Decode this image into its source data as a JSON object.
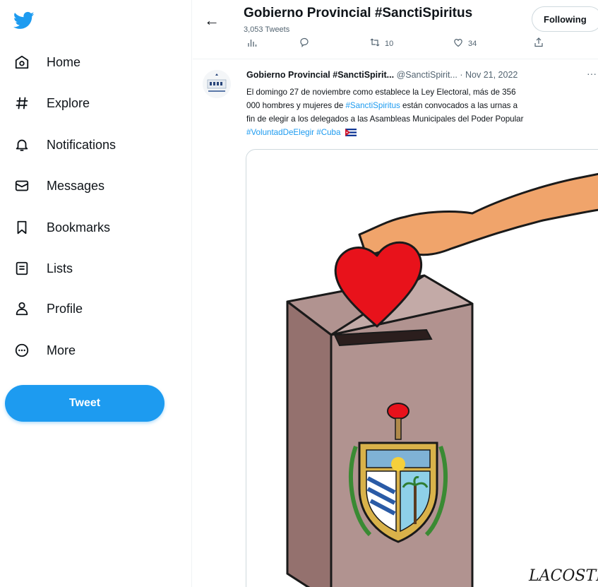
{
  "sidebar": {
    "items": [
      {
        "label": "Home",
        "icon": "home-icon"
      },
      {
        "label": "Explore",
        "icon": "hashtag-icon"
      },
      {
        "label": "Notifications",
        "icon": "bell-icon"
      },
      {
        "label": "Messages",
        "icon": "envelope-icon"
      },
      {
        "label": "Bookmarks",
        "icon": "bookmark-icon"
      },
      {
        "label": "Lists",
        "icon": "list-icon"
      },
      {
        "label": "Profile",
        "icon": "person-icon"
      },
      {
        "label": "More",
        "icon": "more-circle-icon"
      }
    ],
    "tweet_button": "Tweet"
  },
  "header": {
    "title": "Gobierno Provincial #SanctiSpiritus",
    "tweet_count": "3,053 Tweets",
    "follow_button": "Following",
    "actions": {
      "replies": "",
      "retweets": "10",
      "likes": "34"
    }
  },
  "tweet": {
    "name": "Gobierno Provincial #SanctiSpirit...",
    "handle": "@SanctiSpirit...",
    "date": "· Nov 21, 2022",
    "text": {
      "line1": "El domingo 27 de noviembre como establece la Ley Electoral, más de 356",
      "line2_pre": "000 hombres y mujeres de ",
      "line2_link": "#SanctiSpiritus",
      "line2_post": " están convocados a las urnas a",
      "line3": "fin de elegir a los delegados a las Asambleas Municipales del Poder Popular",
      "line4_link": "#VoluntadDeElegir #Cuba"
    },
    "image_signature": "LACOSTE."
  },
  "colors": {
    "accent": "#1d9bf0",
    "heart": "#e8121b",
    "ballot_box": "#a98b87"
  }
}
